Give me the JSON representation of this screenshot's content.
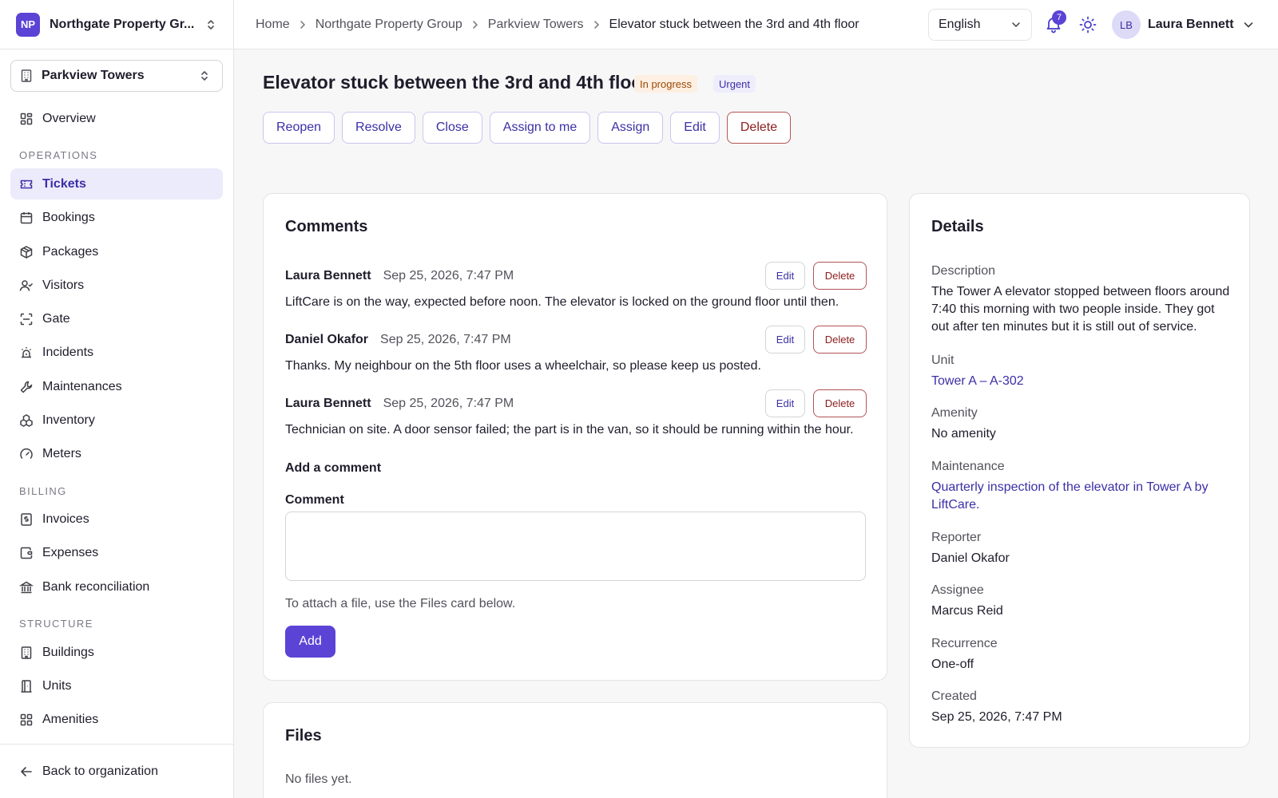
{
  "org": {
    "initials": "NP",
    "name": "Northgate Property Gr..."
  },
  "building": {
    "name": "Parkview Towers"
  },
  "nav": {
    "overview": "Overview",
    "section_operations": "OPERATIONS",
    "tickets": "Tickets",
    "bookings": "Bookings",
    "packages": "Packages",
    "visitors": "Visitors",
    "gate": "Gate",
    "incidents": "Incidents",
    "maintenances": "Maintenances",
    "inventory": "Inventory",
    "meters": "Meters",
    "section_billing": "BILLING",
    "invoices": "Invoices",
    "expenses": "Expenses",
    "bank_reconciliation": "Bank reconciliation",
    "section_structure": "STRUCTURE",
    "buildings": "Buildings",
    "units": "Units",
    "amenities": "Amenities",
    "back": "Back to organization"
  },
  "breadcrumb": [
    "Home",
    "Northgate Property Group",
    "Parkview Towers",
    "Elevator stuck between the 3rd and 4th floor"
  ],
  "topbar": {
    "language": "English",
    "notifications": "7",
    "user_initials": "LB",
    "user_name": "Laura Bennett"
  },
  "ticket": {
    "title": "Elevator stuck between the 3rd and 4th floor",
    "status": "In progress",
    "priority": "Urgent",
    "actions": {
      "reopen": "Reopen",
      "resolve": "Resolve",
      "close": "Close",
      "assign_to_me": "Assign to me",
      "assign": "Assign",
      "edit": "Edit",
      "delete": "Delete"
    }
  },
  "comments": {
    "title": "Comments",
    "edit_label": "Edit",
    "delete_label": "Delete",
    "items": [
      {
        "author": "Laura Bennett",
        "date": "Sep 25, 2026, 7:47 PM",
        "body": "LiftCare is on the way, expected before noon. The elevator is locked on the ground floor until then."
      },
      {
        "author": "Daniel Okafor",
        "date": "Sep 25, 2026, 7:47 PM",
        "body": "Thanks. My neighbour on the 5th floor uses a wheelchair, so please keep us posted."
      },
      {
        "author": "Laura Bennett",
        "date": "Sep 25, 2026, 7:47 PM",
        "body": "Technician on site. A door sensor failed; the part is in the van, so it should be running within the hour."
      }
    ],
    "add_title": "Add a comment",
    "field_label": "Comment",
    "field_value": "",
    "hint": "To attach a file, use the Files card below.",
    "add_button": "Add"
  },
  "files": {
    "title": "Files",
    "empty": "No files yet."
  },
  "details": {
    "title": "Details",
    "description_label": "Description",
    "description": "The Tower A elevator stopped between floors around 7:40 this morning with two people inside. They got out after ten minutes but it is still out of service.",
    "unit_label": "Unit",
    "unit": "Tower A – A-302",
    "amenity_label": "Amenity",
    "amenity": "No amenity",
    "maintenance_label": "Maintenance",
    "maintenance": "Quarterly inspection of the elevator in Tower A by LiftCare.",
    "reporter_label": "Reporter",
    "reporter": "Daniel Okafor",
    "assignee_label": "Assignee",
    "assignee": "Marcus Reid",
    "recurrence_label": "Recurrence",
    "recurrence": "One-off",
    "created_label": "Created",
    "created": "Sep 25, 2026, 7:47 PM"
  },
  "colors": {
    "accent": "#5b43d6",
    "accent_text": "#3b2fa6",
    "danger": "#8b1e1e",
    "status_bg": "#fdefe1",
    "status_text": "#9a4a09"
  }
}
